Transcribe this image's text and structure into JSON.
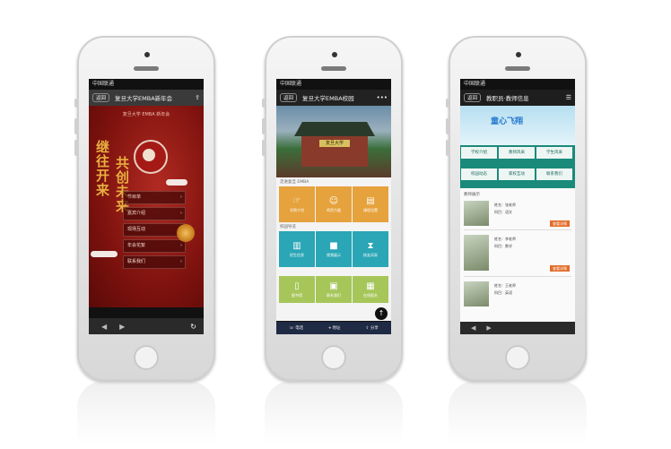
{
  "phones": {
    "p1": {
      "status": "中国联通",
      "back": "返回",
      "title": "复旦大学EMBA新年会",
      "subtitle": "复旦大学 EMBA 新年会",
      "calligraphy_1": "继往开来",
      "calligraphy_2": "共创未来",
      "menu": [
        "节目单",
        "嘉宾介绍",
        "现场互动",
        "年会花絮",
        "联系我们"
      ]
    },
    "p2": {
      "status": "中国联通",
      "back": "返回",
      "title": "复旦大学EMBA校园",
      "plaque": "复旦大学",
      "section_1": "走进复旦 EMBA",
      "section_2": "校园导览",
      "tiles_row1": [
        "学院介绍",
        "师资力量",
        "课程设置"
      ],
      "tiles_row2": [
        "招生信息",
        "视频展示",
        "校友风采"
      ],
      "tiles_row3": [
        "图书馆",
        "联系我们",
        "在线报名"
      ],
      "tab_1": "电话",
      "tab_2": "地址",
      "tab_3": "分享"
    },
    "p3": {
      "status": "中国联通",
      "back": "返回",
      "title": "教职员·教师信息",
      "banner": "童心飞翔",
      "buttons": [
        "学校介绍",
        "教师风采",
        "学生风采",
        "校园动态",
        "家校互动",
        "联系我们"
      ],
      "list_header": "教师展示",
      "cards": [
        {
          "name": "姓名：张老师",
          "subject": "科目：语文",
          "action": "查看详情"
        },
        {
          "name": "姓名：李老师",
          "subject": "科目：数学",
          "action": "查看详情"
        },
        {
          "name": "姓名：王老师",
          "subject": "科目：英语",
          "action": ""
        }
      ]
    }
  },
  "colors": {
    "red_bg": "#7e120e",
    "gold": "#e8b040",
    "tile_orange": "#e6a23c",
    "tile_teal": "#2aa6b6",
    "tile_green": "#a6c65a",
    "teal_panel": "#1a8a7a",
    "orange_btn": "#e36c2a"
  }
}
